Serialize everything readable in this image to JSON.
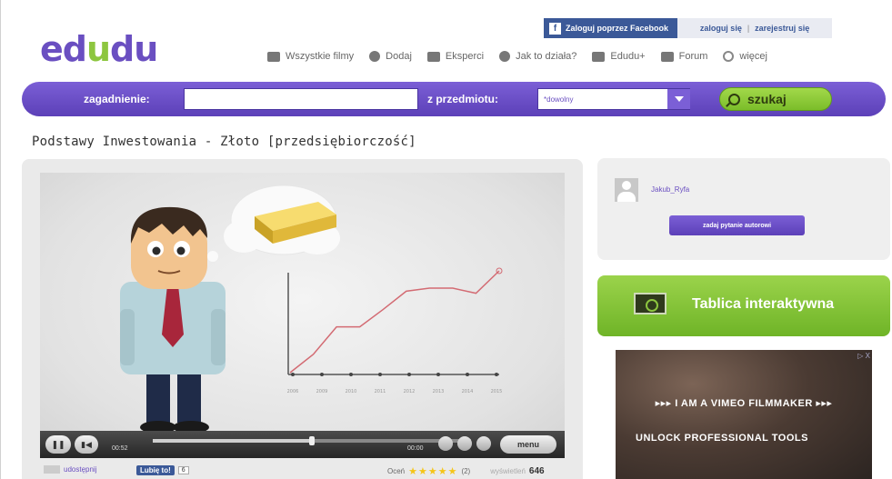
{
  "logo": {
    "part1": "ed",
    "part2": "u",
    "part3": "du"
  },
  "auth": {
    "facebook_login": "Zaloguj poprzez Facebook",
    "login": "zaloguj się",
    "separator": "|",
    "register": "zarejestruj się"
  },
  "nav": {
    "items": [
      {
        "label": "Wszystkie filmy",
        "icon": "film-icon"
      },
      {
        "label": "Dodaj",
        "icon": "add-icon"
      },
      {
        "label": "Eksperci",
        "icon": "experts-icon"
      },
      {
        "label": "Jak to działa?",
        "icon": "question-icon"
      },
      {
        "label": "Edudu+",
        "icon": "lock-icon"
      },
      {
        "label": "Forum",
        "icon": "forum-icon"
      },
      {
        "label": "więcej",
        "icon": "more-icon"
      }
    ]
  },
  "search": {
    "topic_label": "zagadnienie:",
    "topic_value": "",
    "subject_label": "z przedmiotu:",
    "subject_value": "*dowolny",
    "button_label": "szukaj"
  },
  "page_title": "Podstawy Inwestowania - Złoto [przedsiębiorczość]",
  "player": {
    "current_time": "00:52",
    "duration": "00:00",
    "menu_label": "menu",
    "progress_fraction": 0.5,
    "chart_years": [
      "2006",
      "2009",
      "2010",
      "2011",
      "2012",
      "2013",
      "2014",
      "2015"
    ]
  },
  "below_video": {
    "share_label": "udostępnij",
    "like_label": "Lubię to!",
    "like_count": "6",
    "rating_label": "Oceń",
    "rating_stars": "★★★★★",
    "rating_count": "(2)",
    "views_label": "wyświetleń",
    "views_value": "646"
  },
  "author": {
    "name": "Jakub_Ryfa",
    "ask_button": "zadaj pytanie autorowi"
  },
  "board": {
    "label": "Tablica interaktywna"
  },
  "ad": {
    "close_label": "▷ X",
    "line1": "▸▸▸ I AM A VIMEO FILMMAKER ▸▸▸",
    "line2": "UNLOCK PROFESSIONAL TOOLS"
  },
  "colors": {
    "brand_purple": "#6a4fc1",
    "brand_green": "#8dc63f",
    "facebook_blue": "#3b5998",
    "chart_line": "#d36b73"
  }
}
